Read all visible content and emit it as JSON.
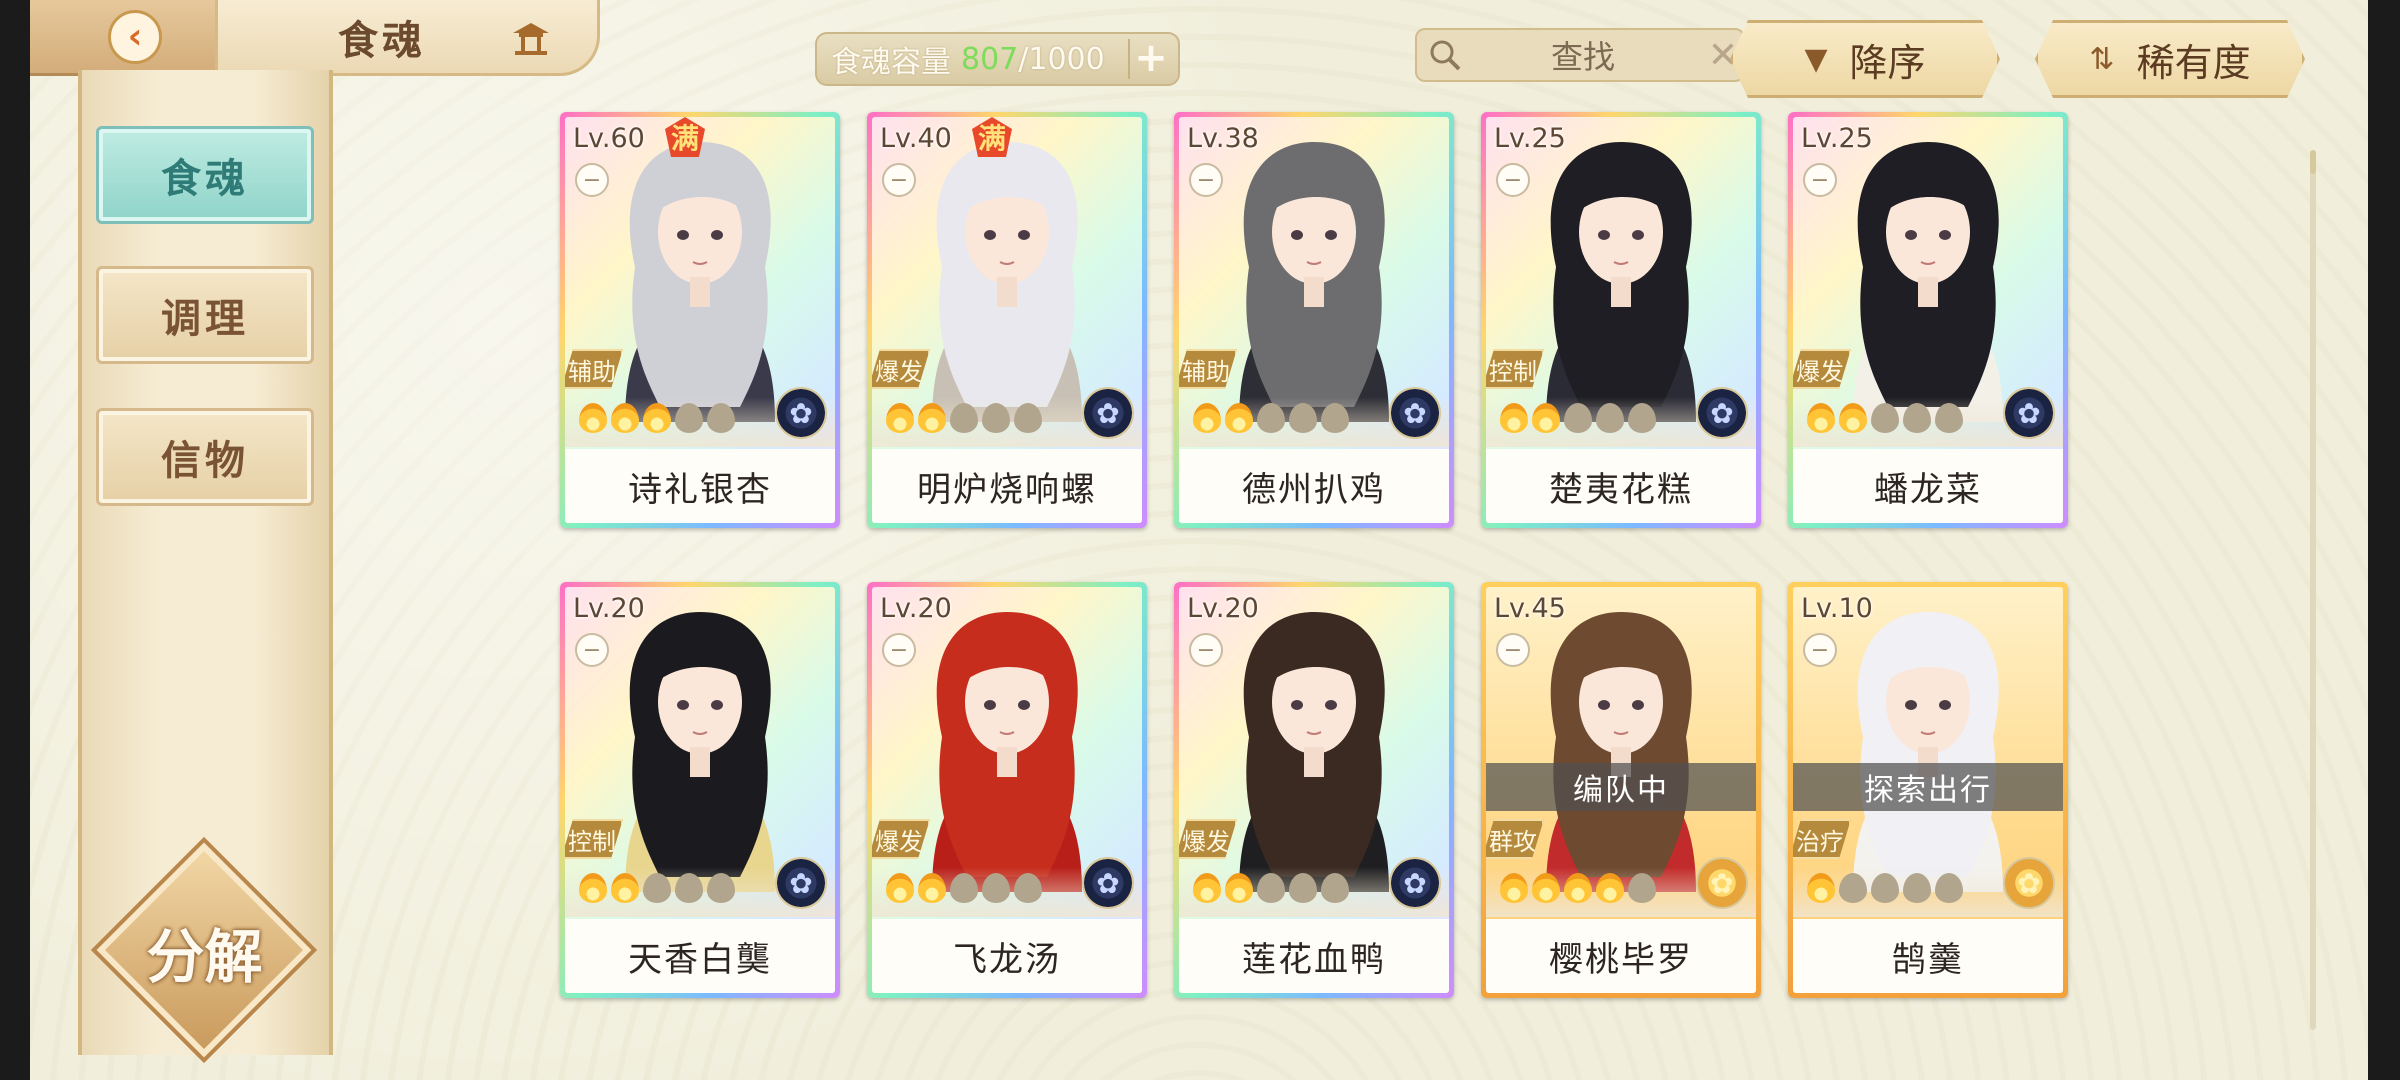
{
  "header": {
    "back_icon": "back-arrow-icon",
    "title": "食魂",
    "home_icon": "pavilion-home-icon",
    "capacity": {
      "label": "食魂容量",
      "current": "807",
      "max": "/1000",
      "add_label": "+"
    },
    "search": {
      "placeholder": "查找",
      "clear_label": "✕"
    },
    "sort_order": {
      "label": "降序",
      "icon": "triangle-down-icon"
    },
    "sort_key": {
      "label": "稀有度",
      "icon": "sort-arrows-icon"
    }
  },
  "sidebar": {
    "items": [
      {
        "label": "食魂",
        "active": true
      },
      {
        "label": "调理",
        "active": false
      },
      {
        "label": "信物",
        "active": false
      }
    ],
    "decompose_label": "分解"
  },
  "colors": {
    "accent_teal": "#8fd3c9",
    "gold": "#f2a13b",
    "capacity_green": "#7ddc5a",
    "role_badge": "#b68a3d"
  },
  "cards": [
    {
      "level": "Lv.60",
      "max_badge": "满",
      "role": "辅助",
      "name": "诗礼银杏",
      "stars": 3,
      "stars_total": 5,
      "element": "water",
      "frame": "rainbow",
      "status": ""
    },
    {
      "level": "Lv.40",
      "max_badge": "满",
      "role": "爆发",
      "name": "明炉烧响螺",
      "stars": 2,
      "stars_total": 5,
      "element": "water",
      "frame": "rainbow",
      "status": ""
    },
    {
      "level": "Lv.38",
      "max_badge": "",
      "role": "辅助",
      "name": "德州扒鸡",
      "stars": 2,
      "stars_total": 5,
      "element": "water",
      "frame": "rainbow",
      "status": ""
    },
    {
      "level": "Lv.25",
      "max_badge": "",
      "role": "控制",
      "name": "楚夷花糕",
      "stars": 2,
      "stars_total": 5,
      "element": "water",
      "frame": "rainbow",
      "status": ""
    },
    {
      "level": "Lv.25",
      "max_badge": "",
      "role": "爆发",
      "name": "蟠龙菜",
      "stars": 2,
      "stars_total": 5,
      "element": "water",
      "frame": "rainbow",
      "status": ""
    },
    {
      "level": "Lv.20",
      "max_badge": "",
      "role": "控制",
      "name": "天香白龑",
      "stars": 2,
      "stars_total": 5,
      "element": "water",
      "frame": "rainbow",
      "status": ""
    },
    {
      "level": "Lv.20",
      "max_badge": "",
      "role": "爆发",
      "name": "飞龙汤",
      "stars": 2,
      "stars_total": 5,
      "element": "water",
      "frame": "rainbow",
      "status": ""
    },
    {
      "level": "Lv.20",
      "max_badge": "",
      "role": "爆发",
      "name": "莲花血鸭",
      "stars": 2,
      "stars_total": 5,
      "element": "water",
      "frame": "rainbow",
      "status": ""
    },
    {
      "level": "Lv.45",
      "max_badge": "",
      "role": "群攻",
      "name": "樱桃毕罗",
      "stars": 4,
      "stars_total": 5,
      "element": "fire",
      "frame": "gold",
      "status": "编队中"
    },
    {
      "level": "Lv.10",
      "max_badge": "",
      "role": "治疗",
      "name": "鹄羹",
      "stars": 1,
      "stars_total": 5,
      "element": "fire",
      "frame": "gold",
      "status": "探索出行"
    }
  ]
}
